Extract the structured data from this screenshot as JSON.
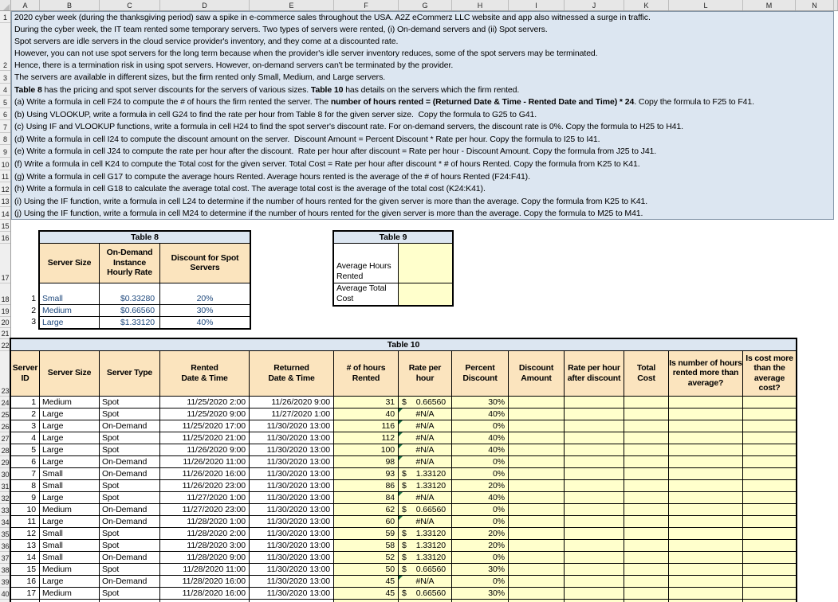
{
  "grid": {
    "column_letters": [
      "A",
      "B",
      "C",
      "D",
      "E",
      "F",
      "G",
      "H",
      "I",
      "J",
      "K",
      "L",
      "M",
      "N"
    ],
    "row_numbers": [
      "1",
      "2",
      "3",
      "4",
      "5",
      "6",
      "7",
      "8",
      "9",
      "10",
      "11",
      "12",
      "13",
      "14",
      "15",
      "16",
      "17",
      "18",
      "19",
      "20",
      "21",
      "22",
      "23",
      "24",
      "25",
      "26",
      "27",
      "28",
      "29",
      "30",
      "31",
      "32",
      "33",
      "34",
      "35",
      "36",
      "37",
      "38",
      "39",
      "40"
    ]
  },
  "colors": {
    "fill_blue": "#DCE6F1",
    "fill_tan": "#FBE4BE",
    "fill_yellow": "#FFFFCC",
    "error_indicator_green": "#1E7145",
    "input_text_blue": "#1F497D"
  },
  "instructions": {
    "lines": [
      {
        "segments": [
          {
            "text": "2020 cyber week (during the thanksgiving period) saw a spike in e-commerce sales throughout the USA. A2Z eCommerz LLC website and app also witnessed a surge in traffic.",
            "bold": false
          }
        ]
      },
      {
        "segments": [
          {
            "text": "During the cyber week, the IT team rented some temporary servers. Two types of servers were rented, (i) On-demand servers and (ii) Spot servers.",
            "bold": false
          }
        ]
      },
      {
        "segments": [
          {
            "text": "Spot servers are idle servers in the cloud service provider's inventory, and they come at a discounted rate.",
            "bold": false
          }
        ]
      },
      {
        "segments": [
          {
            "text": "However, you can not use spot servers for the long term because when the provider's idle server inventory reduces, some of the spot servers may be terminated.",
            "bold": false
          }
        ]
      },
      {
        "segments": [
          {
            "text": "Hence, there is a termination risk in using spot servers. However, on-demand servers can't be terminated by the provider.",
            "bold": false
          }
        ]
      },
      {
        "segments": [
          {
            "text": "The servers are available in different sizes, but the firm rented only Small, Medium, and Large servers.",
            "bold": false
          }
        ]
      },
      {
        "segments": [
          {
            "text": "Table 8",
            "bold": true
          },
          {
            "text": " has the pricing and spot server discounts for the servers of various sizes. ",
            "bold": false
          },
          {
            "text": "Table 10",
            "bold": true
          },
          {
            "text": " has details on the servers which the firm rented.",
            "bold": false
          }
        ]
      },
      {
        "segments": [
          {
            "text": "(a) Write a formula in cell F24 to compute the # of hours the firm rented the server. The ",
            "bold": false
          },
          {
            "text": "number of hours rented = (Returned Date & Time - Rented Date and Time) * 24",
            "bold": true
          },
          {
            "text": ". Copy the formula to F25 to F41.",
            "bold": false
          }
        ]
      },
      {
        "segments": [
          {
            "text": "(b) Using VLOOKUP, write a formula in cell G24 to find the rate per hour from Table 8 for the given server size.  Copy the formula to G25 to G41.",
            "bold": false
          }
        ]
      },
      {
        "segments": [
          {
            "text": "(c) Using IF and VLOOKUP functions, write a formula in cell H24 to find the spot server's discount rate. For on-demand servers, the discount rate is 0%. Copy the formula to H25 to H41.",
            "bold": false
          }
        ]
      },
      {
        "segments": [
          {
            "text": "(d) Write a formula in cell I24 to compute the discount amount on the server.  Discount Amount = Percent Discount * Rate per hour. Copy the formula to I25 to I41.",
            "bold": false
          }
        ]
      },
      {
        "segments": [
          {
            "text": "(e) Write a formula in cell J24 to compute the rate per hour after the discount.  Rate per hour after discount = Rate per hour - Discount Amount. Copy the formula from J25 to J41.",
            "bold": false
          }
        ]
      },
      {
        "segments": [
          {
            "text": "(f) Write a formula in cell K24 to compute the Total cost for the given server. Total Cost = Rate per hour after discount * # of hours Rented. Copy the formula from K25 to K41.",
            "bold": false
          }
        ]
      },
      {
        "segments": [
          {
            "text": "(g) Write a formula in cell G17 to compute the average hours Rented. Average hours rented is the average of the # of hours Rented (F24:F41).",
            "bold": false
          }
        ]
      },
      {
        "segments": [
          {
            "text": "(h) Write a formula in cell G18 to calculate the average total cost. The average total cost is the average of the total cost (K24:K41).",
            "bold": false
          }
        ]
      },
      {
        "segments": [
          {
            "text": "(i) Using the IF function, write a formula in cell L24 to determine if the number of hours rented for the given server is more than the average. Copy the formula from K25 to K41.",
            "bold": false
          }
        ]
      },
      {
        "segments": [
          {
            "text": "(j) Using the IF function, write a formula in cell M24 to determine if the number of hours rented for the given server is more than the average. Copy the formula to M25 to M41.",
            "bold": false
          }
        ]
      }
    ]
  },
  "table8": {
    "title": "Table 8",
    "headers": [
      "Server Size",
      "On-Demand\nInstance\nHourly Rate",
      "Discount for Spot\nServers"
    ],
    "row_indices": [
      "1",
      "2",
      "3"
    ],
    "rows": [
      {
        "size": "Small",
        "rate": "$0.33280",
        "discount": "20%"
      },
      {
        "size": "Medium",
        "rate": "$0.66560",
        "discount": "30%"
      },
      {
        "size": "Large",
        "rate": "$1.33120",
        "discount": "40%"
      }
    ]
  },
  "table9": {
    "title": "Table 9",
    "rows": [
      {
        "label": "Average Hours Rented",
        "value": ""
      },
      {
        "label": "Average Total Cost",
        "value": ""
      }
    ]
  },
  "table10": {
    "title": "Table 10",
    "currency_symbol": "$",
    "na_text": "#N/A",
    "headers": [
      "Server\nID",
      "Server Size",
      "Server Type",
      "Rented\nDate & Time",
      "Returned\nDate & Time",
      "# of hours\nRented",
      "Rate per\nhour",
      "Percent\nDiscount",
      "Discount\nAmount",
      "Rate per hour\nafter discount",
      "Total\nCost",
      "Is number of hours\nrented more than\naverage?",
      "Is cost more\nthan the\naverage\ncost?"
    ],
    "rows": [
      {
        "id": "1",
        "size": "Medium",
        "type": "Spot",
        "rented": "11/25/2020 2:00",
        "returned": "11/26/2020 9:00",
        "hours": "31",
        "rate": "0.66560",
        "rate_na": false,
        "discount": "30%",
        "discount_amount": "",
        "rate_after": "",
        "total": "",
        "more_hours": "",
        "more_cost": ""
      },
      {
        "id": "2",
        "size": "Large",
        "type": "Spot",
        "rented": "11/25/2020 9:00",
        "returned": "11/27/2020 1:00",
        "hours": "40",
        "rate": "",
        "rate_na": true,
        "discount": "40%",
        "discount_amount": "",
        "rate_after": "",
        "total": "",
        "more_hours": "",
        "more_cost": ""
      },
      {
        "id": "3",
        "size": "Large",
        "type": "On-Demand",
        "rented": "11/25/2020 17:00",
        "returned": "11/30/2020 13:00",
        "hours": "116",
        "rate": "",
        "rate_na": true,
        "discount": "0%",
        "discount_amount": "",
        "rate_after": "",
        "total": "",
        "more_hours": "",
        "more_cost": ""
      },
      {
        "id": "4",
        "size": "Large",
        "type": "Spot",
        "rented": "11/25/2020 21:00",
        "returned": "11/30/2020 13:00",
        "hours": "112",
        "rate": "",
        "rate_na": true,
        "discount": "40%",
        "discount_amount": "",
        "rate_after": "",
        "total": "",
        "more_hours": "",
        "more_cost": ""
      },
      {
        "id": "5",
        "size": "Large",
        "type": "Spot",
        "rented": "11/26/2020 9:00",
        "returned": "11/30/2020 13:00",
        "hours": "100",
        "rate": "",
        "rate_na": true,
        "discount": "40%",
        "discount_amount": "",
        "rate_after": "",
        "total": "",
        "more_hours": "",
        "more_cost": ""
      },
      {
        "id": "6",
        "size": "Large",
        "type": "On-Demand",
        "rented": "11/26/2020 11:00",
        "returned": "11/30/2020 13:00",
        "hours": "98",
        "rate": "",
        "rate_na": true,
        "discount": "0%",
        "discount_amount": "",
        "rate_after": "",
        "total": "",
        "more_hours": "",
        "more_cost": ""
      },
      {
        "id": "7",
        "size": "Small",
        "type": "On-Demand",
        "rented": "11/26/2020 16:00",
        "returned": "11/30/2020 13:00",
        "hours": "93",
        "rate": "1.33120",
        "rate_na": false,
        "discount": "0%",
        "discount_amount": "",
        "rate_after": "",
        "total": "",
        "more_hours": "",
        "more_cost": ""
      },
      {
        "id": "8",
        "size": "Small",
        "type": "Spot",
        "rented": "11/26/2020 23:00",
        "returned": "11/30/2020 13:00",
        "hours": "86",
        "rate": "1.33120",
        "rate_na": false,
        "discount": "20%",
        "discount_amount": "",
        "rate_after": "",
        "total": "",
        "more_hours": "",
        "more_cost": ""
      },
      {
        "id": "9",
        "size": "Large",
        "type": "Spot",
        "rented": "11/27/2020 1:00",
        "returned": "11/30/2020 13:00",
        "hours": "84",
        "rate": "",
        "rate_na": true,
        "discount": "40%",
        "discount_amount": "",
        "rate_after": "",
        "total": "",
        "more_hours": "",
        "more_cost": ""
      },
      {
        "id": "10",
        "size": "Medium",
        "type": "On-Demand",
        "rented": "11/27/2020 23:00",
        "returned": "11/30/2020 13:00",
        "hours": "62",
        "rate": "0.66560",
        "rate_na": false,
        "discount": "0%",
        "discount_amount": "",
        "rate_after": "",
        "total": "",
        "more_hours": "",
        "more_cost": ""
      },
      {
        "id": "11",
        "size": "Large",
        "type": "On-Demand",
        "rented": "11/28/2020 1:00",
        "returned": "11/30/2020 13:00",
        "hours": "60",
        "rate": "",
        "rate_na": true,
        "discount": "0%",
        "discount_amount": "",
        "rate_after": "",
        "total": "",
        "more_hours": "",
        "more_cost": ""
      },
      {
        "id": "12",
        "size": "Small",
        "type": "Spot",
        "rented": "11/28/2020 2:00",
        "returned": "11/30/2020 13:00",
        "hours": "59",
        "rate": "1.33120",
        "rate_na": false,
        "discount": "20%",
        "discount_amount": "",
        "rate_after": "",
        "total": "",
        "more_hours": "",
        "more_cost": ""
      },
      {
        "id": "13",
        "size": "Small",
        "type": "Spot",
        "rented": "11/28/2020 3:00",
        "returned": "11/30/2020 13:00",
        "hours": "58",
        "rate": "1.33120",
        "rate_na": false,
        "discount": "20%",
        "discount_amount": "",
        "rate_after": "",
        "total": "",
        "more_hours": "",
        "more_cost": ""
      },
      {
        "id": "14",
        "size": "Small",
        "type": "On-Demand",
        "rented": "11/28/2020 9:00",
        "returned": "11/30/2020 13:00",
        "hours": "52",
        "rate": "1.33120",
        "rate_na": false,
        "discount": "0%",
        "discount_amount": "",
        "rate_after": "",
        "total": "",
        "more_hours": "",
        "more_cost": ""
      },
      {
        "id": "15",
        "size": "Medium",
        "type": "Spot",
        "rented": "11/28/2020 11:00",
        "returned": "11/30/2020 13:00",
        "hours": "50",
        "rate": "0.66560",
        "rate_na": false,
        "discount": "30%",
        "discount_amount": "",
        "rate_after": "",
        "total": "",
        "more_hours": "",
        "more_cost": ""
      },
      {
        "id": "16",
        "size": "Large",
        "type": "On-Demand",
        "rented": "11/28/2020 16:00",
        "returned": "11/30/2020 13:00",
        "hours": "45",
        "rate": "",
        "rate_na": true,
        "discount": "0%",
        "discount_amount": "",
        "rate_after": "",
        "total": "",
        "more_hours": "",
        "more_cost": ""
      },
      {
        "id": "17",
        "size": "Medium",
        "type": "Spot",
        "rented": "11/28/2020 16:00",
        "returned": "11/30/2020 13:00",
        "hours": "45",
        "rate": "0.66560",
        "rate_na": false,
        "discount": "30%",
        "discount_amount": "",
        "rate_after": "",
        "total": "",
        "more_hours": "",
        "more_cost": ""
      }
    ],
    "partial_row": true
  }
}
